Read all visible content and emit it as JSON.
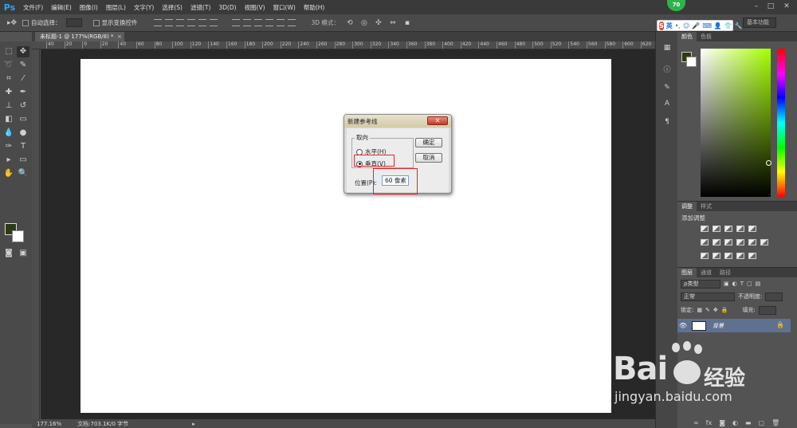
{
  "app": {
    "logo": "Ps"
  },
  "menu": [
    "文件(F)",
    "编辑(E)",
    "图像(I)",
    "图层(L)",
    "文字(Y)",
    "选择(S)",
    "滤镜(T)",
    "3D(D)",
    "视图(V)",
    "窗口(W)",
    "帮助(H)"
  ],
  "window_controls": {
    "minimize": "–",
    "maximize": "□",
    "close": "✕"
  },
  "options": {
    "auto_select_label": "自动选择：",
    "show_transform_label": "显示变换控件",
    "mode3d_label": "3D 模式：",
    "workspace": "基本功能"
  },
  "document": {
    "tab_title": "未标题-1 @ 177%(RGB/8) *",
    "tab_close": "×",
    "ruler_ticks": [
      "40",
      "20",
      "0",
      "20",
      "40",
      "60",
      "80",
      "100",
      "120",
      "140",
      "160",
      "180",
      "200",
      "220",
      "240",
      "260",
      "280",
      "300",
      "320",
      "340",
      "360",
      "380",
      "400",
      "420",
      "440",
      "460",
      "480",
      "500",
      "520",
      "540",
      "560",
      "580",
      "600",
      "620"
    ]
  },
  "status": {
    "zoom": "177.16%",
    "doc_info": "文档:703.1K/0 字节"
  },
  "dialog": {
    "title": "新建参考线",
    "close": "✕",
    "orientation_legend": "取向",
    "horizontal_label": "水平(H)",
    "vertical_label": "垂直(V)",
    "selected": "vertical",
    "ok_label": "确定",
    "cancel_label": "取消",
    "position_label": "位置(P):",
    "position_value": "60 像素"
  },
  "panels": {
    "color_tabs": [
      "颜色",
      "色板"
    ],
    "adjust_tabs": [
      "调整",
      "样式"
    ],
    "adjust_title": "添加调整",
    "layers_tabs": [
      "图层",
      "通道",
      "路径"
    ],
    "filter_kind": "ρ类型",
    "blend_mode": "正常",
    "opacity_label": "不透明度:",
    "lock_label": "锁定:",
    "fill_label": "填充:",
    "layer_name": "背景"
  },
  "colors": {
    "foreground": "#2d3b12",
    "background": "#ffffff",
    "layer_selected": "#5f7191",
    "highlight": "#e3262a"
  },
  "ime": {
    "lang": "英",
    "badge": "70"
  },
  "watermark": {
    "brand": "Bai",
    "brand_cn": "经验",
    "url": "jingyan.baidu.com"
  }
}
